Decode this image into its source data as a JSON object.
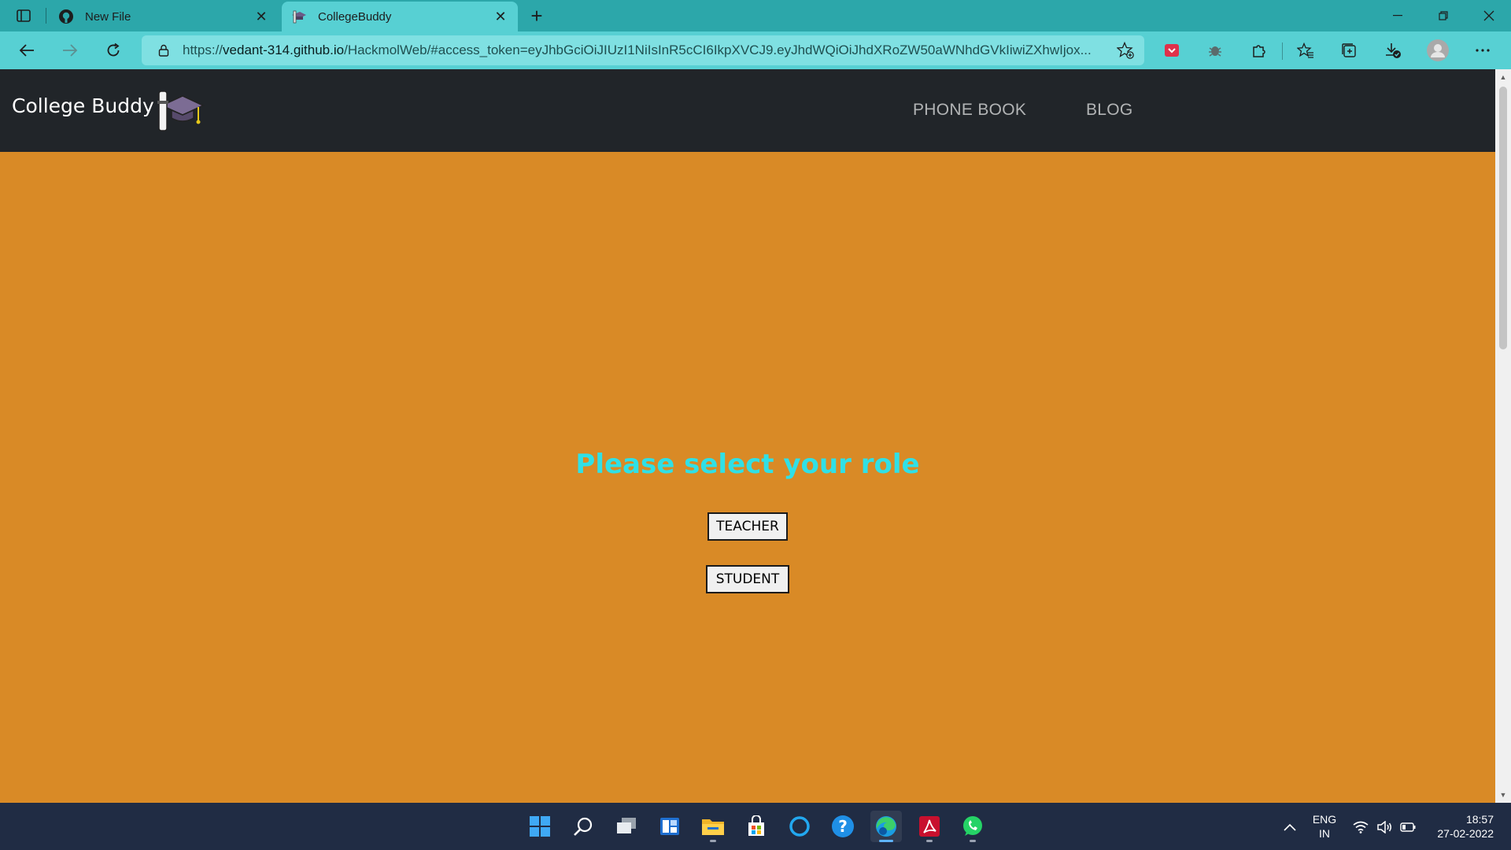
{
  "browser": {
    "tabs": [
      {
        "title": "New File",
        "icon": "github-icon",
        "active": false
      },
      {
        "title": "CollegeBuddy",
        "icon": "graduation-cap-icon",
        "active": true
      }
    ],
    "address": {
      "scheme": "https://",
      "host": "vedant-314.github.io",
      "rest": "/HackmolWeb/#access_token=eyJhbGciOiJIUzI1NiIsInR5cCI6IkpXVCJ9.eyJhdWQiOiJhdXRoZW50aWNhdGVkIiwiZXhwIjox..."
    }
  },
  "site": {
    "brand": "College Buddy",
    "nav": {
      "phone_book": "PHONE BOOK",
      "blog": "BLOG"
    }
  },
  "page": {
    "heading": "Please select your role",
    "teacher_button": "TEACHER",
    "student_button": "STUDENT"
  },
  "colors": {
    "navbar": "#212529",
    "page_bg": "#d98a26",
    "heading": "#30e0e6",
    "tab_strip": "#2ca7aa",
    "toolbar": "#57d0d3"
  },
  "taskbar": {
    "apps": [
      "start-icon",
      "search-icon",
      "task-view-icon",
      "widgets-icon",
      "file-explorer-icon",
      "microsoft-store-icon",
      "cortana-icon",
      "help-icon",
      "edge-icon",
      "acrobat-icon",
      "whatsapp-icon"
    ],
    "language": {
      "line1": "ENG",
      "line2": "IN"
    },
    "clock": {
      "time": "18:57",
      "date": "27-02-2022"
    }
  }
}
